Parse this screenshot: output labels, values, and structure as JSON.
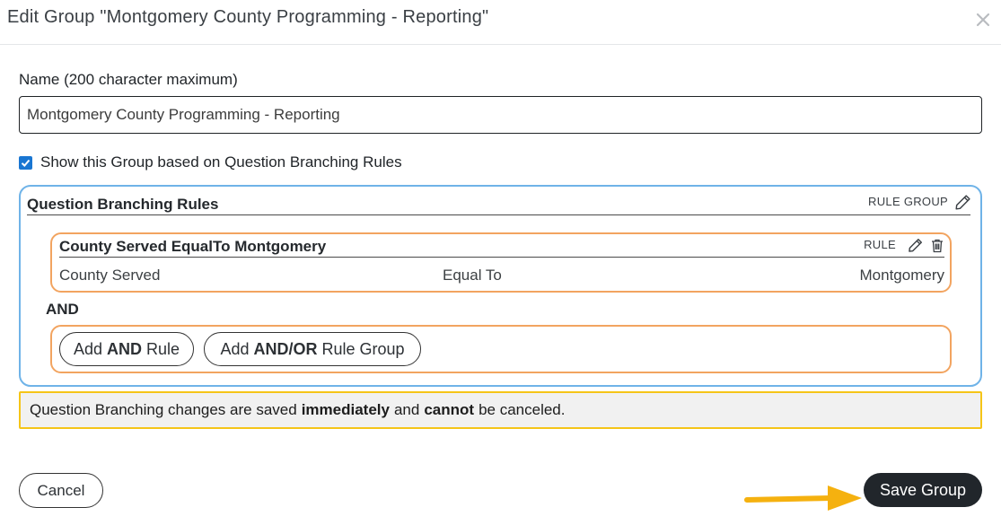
{
  "dialog": {
    "title": "Edit Group \"Montgomery County Programming - Reporting\"",
    "close_icon": "close-icon"
  },
  "name_field": {
    "label": "Name (200 character maximum)",
    "value": "Montgomery County Programming - Reporting"
  },
  "show_group": {
    "checked": true,
    "label": "Show this Group based on Question Branching Rules"
  },
  "rules": {
    "title": "Question Branching Rules",
    "rule_group_label": "RULE GROUP",
    "rule": {
      "title": "County Served EqualTo Montgomery",
      "label": "RULE",
      "question": "County Served",
      "operator": "Equal To",
      "answer": "Montgomery"
    },
    "connector": "AND",
    "add_rule": {
      "prefix": "Add",
      "bold": "AND",
      "suffix": "Rule"
    },
    "add_group": {
      "prefix": "Add",
      "bold": "AND/OR",
      "suffix": "Rule Group"
    }
  },
  "notice": {
    "part1": "Question Branching changes are saved",
    "bold1": "immediately",
    "part2": "and",
    "bold2": "cannot",
    "part3": "be canceled."
  },
  "footer": {
    "cancel_label": "Cancel",
    "save_label": "Save Group"
  },
  "colors": {
    "rule_group_border": "#6fb3e8",
    "rule_border": "#f2a460",
    "notice_border": "#f5c518",
    "save_button_bg": "#21262b",
    "annotation_arrow": "#f5b10f",
    "checkbox": "#1976d2"
  }
}
